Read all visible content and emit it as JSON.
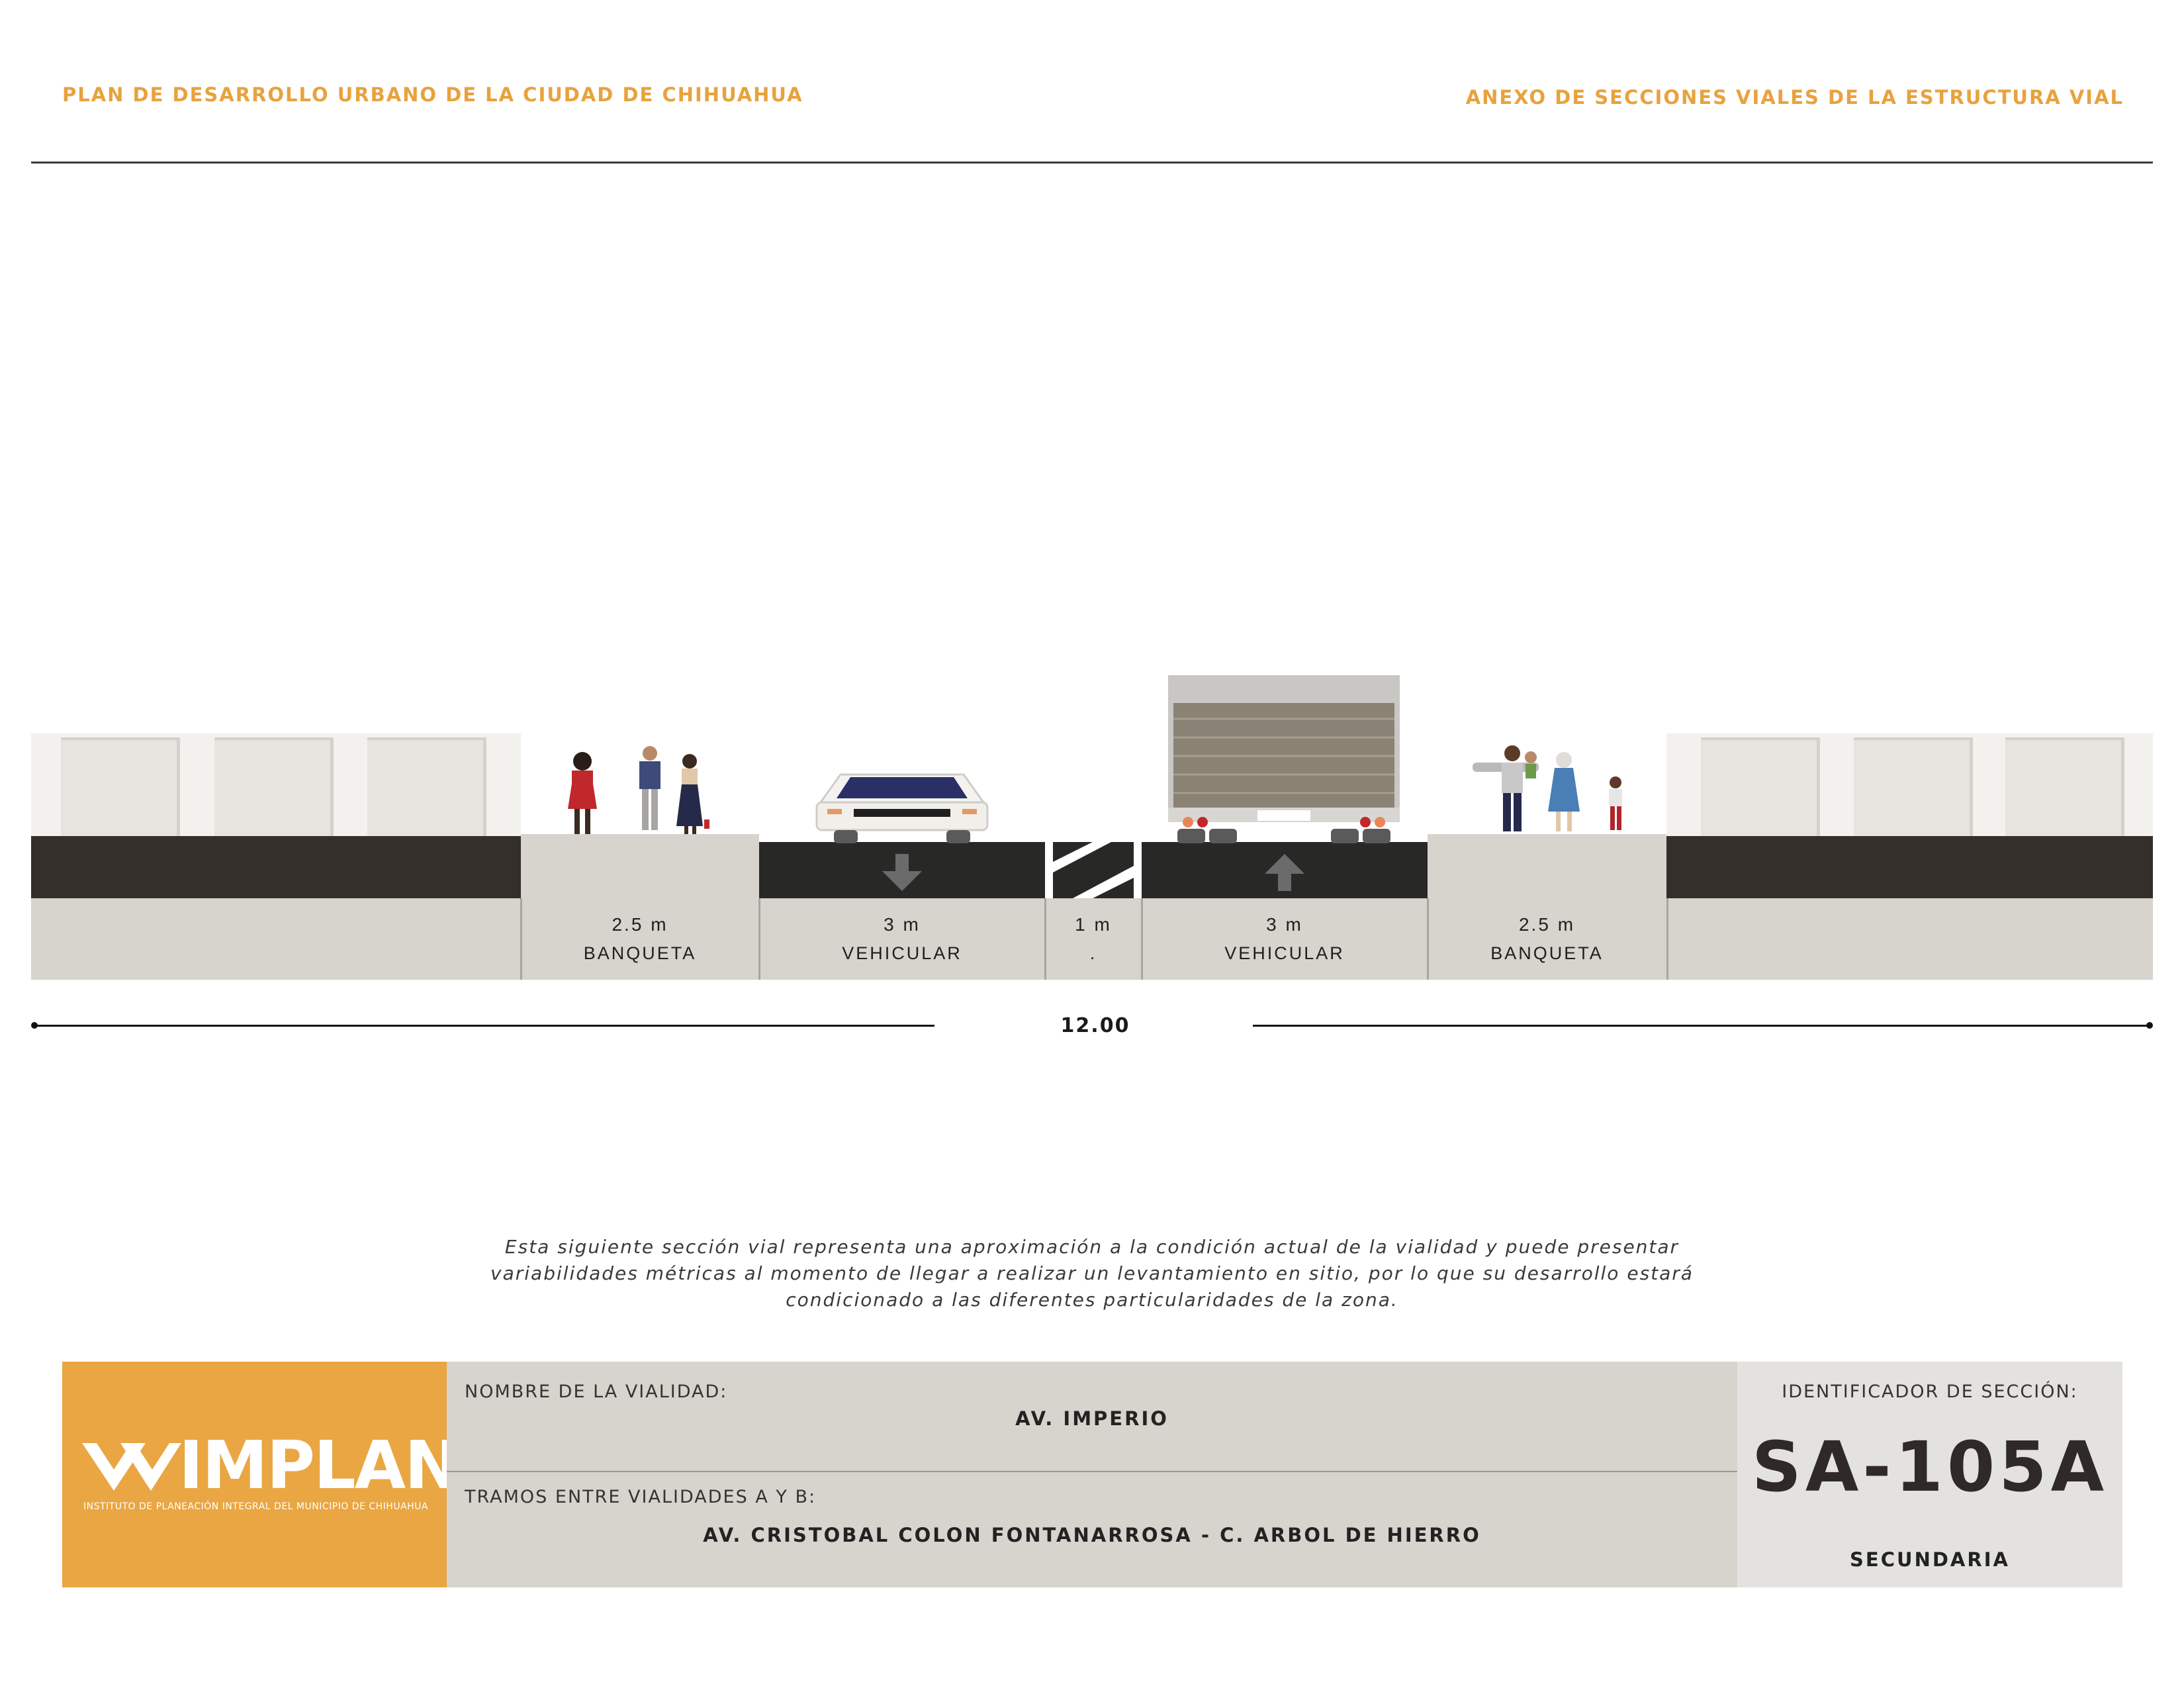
{
  "header": {
    "left_title": "PLAN DE DESARROLLO URBANO DE LA CIUDAD DE CHIHUAHUA",
    "right_title": "ANEXO DE SECCIONES VIALES DE LA ESTRUCTURA VIAL",
    "accent_color": "#E8A23E"
  },
  "section": {
    "segments": [
      {
        "width": "2.5 m",
        "name": "BANQUETA"
      },
      {
        "width": "3 m",
        "name": "VEHICULAR"
      },
      {
        "width": "1 m",
        "name": "."
      },
      {
        "width": "3 m",
        "name": "VEHICULAR"
      },
      {
        "width": "2.5 m",
        "name": "BANQUETA"
      }
    ],
    "total_width": "12.00"
  },
  "note": "Esta siguiente sección vial representa una aproximación a la condición actual de la vialidad y puede presentar variabilidades métricas al momento de llegar a realizar un levantamiento en sitio, por lo que su desarrollo estará condicionado a las diferentes particularidades de la zona.",
  "title_block": {
    "logo_text": "IMPLAN",
    "logo_subtitle": "INSTITUTO DE PLANEACIÓN INTEGRAL DEL MUNICIPIO DE CHIHUAHUA",
    "road_name_label": "NOMBRE DE LA VIALIDAD:",
    "road_name": "AV. IMPERIO",
    "segment_label": "TRAMOS ENTRE VIALIDADES A Y B:",
    "segment_value": "AV. CRISTOBAL COLON FONTANARROSA - C. ARBOL DE HIERRO",
    "section_id_label": "IDENTIFICADOR DE SECCIÓN:",
    "section_id": "SA-105A",
    "road_type": "SECUNDARIA"
  }
}
